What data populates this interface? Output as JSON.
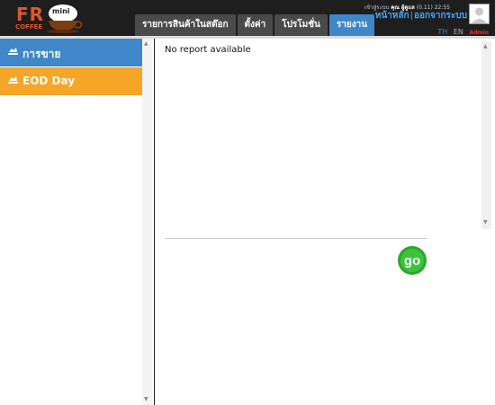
{
  "logo": {
    "brand": "FR",
    "sub": "COFFEE",
    "badge": "mini"
  },
  "tabs": [
    {
      "label": "รายการสินค้าในสต๊อก",
      "active": false
    },
    {
      "label": "ตั้งค่า",
      "active": false
    },
    {
      "label": "โปรโมชั่น",
      "active": false
    },
    {
      "label": "รายงาน",
      "active": true
    }
  ],
  "user": {
    "prefix": "เข้าสู่ระบบ",
    "name": "คุณ ผู้ดูแล",
    "version_time": "(0.11) 22:55",
    "home_link": "หน้าหลัก",
    "logout_link": "ออกจากระบบ",
    "role": "Admin"
  },
  "language": {
    "th": "TH",
    "en": "EN"
  },
  "sidebar": {
    "items": [
      {
        "label": "การขาย",
        "icon": "chart-icon"
      },
      {
        "label": "EOD Day",
        "icon": "chart-icon"
      }
    ]
  },
  "content": {
    "message": "No report available",
    "go_label": "go"
  },
  "colors": {
    "accent_blue": "#3f87c9",
    "accent_orange": "#f5a627",
    "header": "#1e1e1e",
    "go_green": "#2aa82a"
  }
}
